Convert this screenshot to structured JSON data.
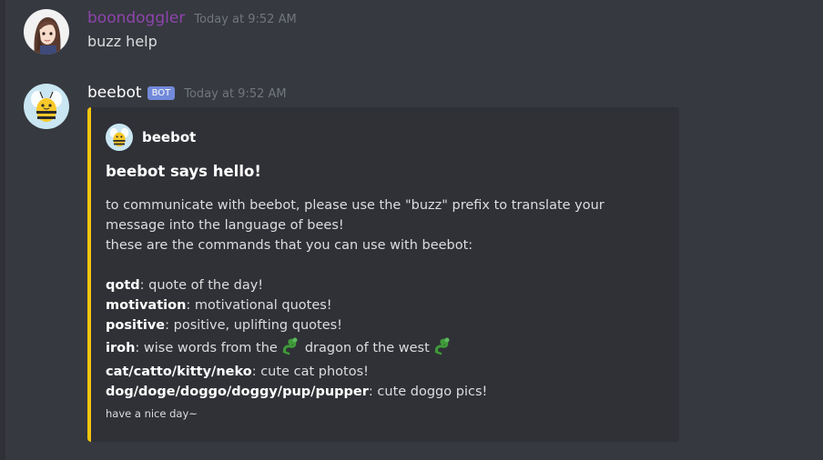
{
  "messages": [
    {
      "username": "boondoggler",
      "username_color": "#8e44ad",
      "timestamp": "Today at 9:52 AM",
      "content": "buzz help",
      "avatar_icon": "anime-girl-avatar"
    },
    {
      "username": "beebot",
      "username_color": "#ffffff",
      "bot_tag": "BOT",
      "timestamp": "Today at 9:52 AM",
      "avatar_icon": "bee-avatar",
      "embed": {
        "accent_color": "#f1c40f",
        "author_name": "beebot",
        "title": "beebot says hello!",
        "intro_lines": [
          "to communicate with beebot, please use the \"buzz\" prefix to translate your",
          "message into the language of bees!",
          "these are the commands that you can use with beebot:"
        ],
        "commands": [
          {
            "name": "qotd",
            "desc": ": quote of the day!"
          },
          {
            "name": "motivation",
            "desc": ": motivational quotes!"
          },
          {
            "name": "positive",
            "desc": ": positive, uplifting quotes!"
          },
          {
            "name": "iroh",
            "desc_before": ": wise words from the",
            "desc_middle": "dragon of the west",
            "icon": "dragon-icon"
          },
          {
            "name": "cat/catto/kitty/neko",
            "desc": ": cute cat photos!"
          },
          {
            "name": "dog/doge/doggo/doggy/pup/pupper",
            "desc": ": cute doggo pics!"
          }
        ],
        "footer": "have a nice day~"
      }
    }
  ]
}
